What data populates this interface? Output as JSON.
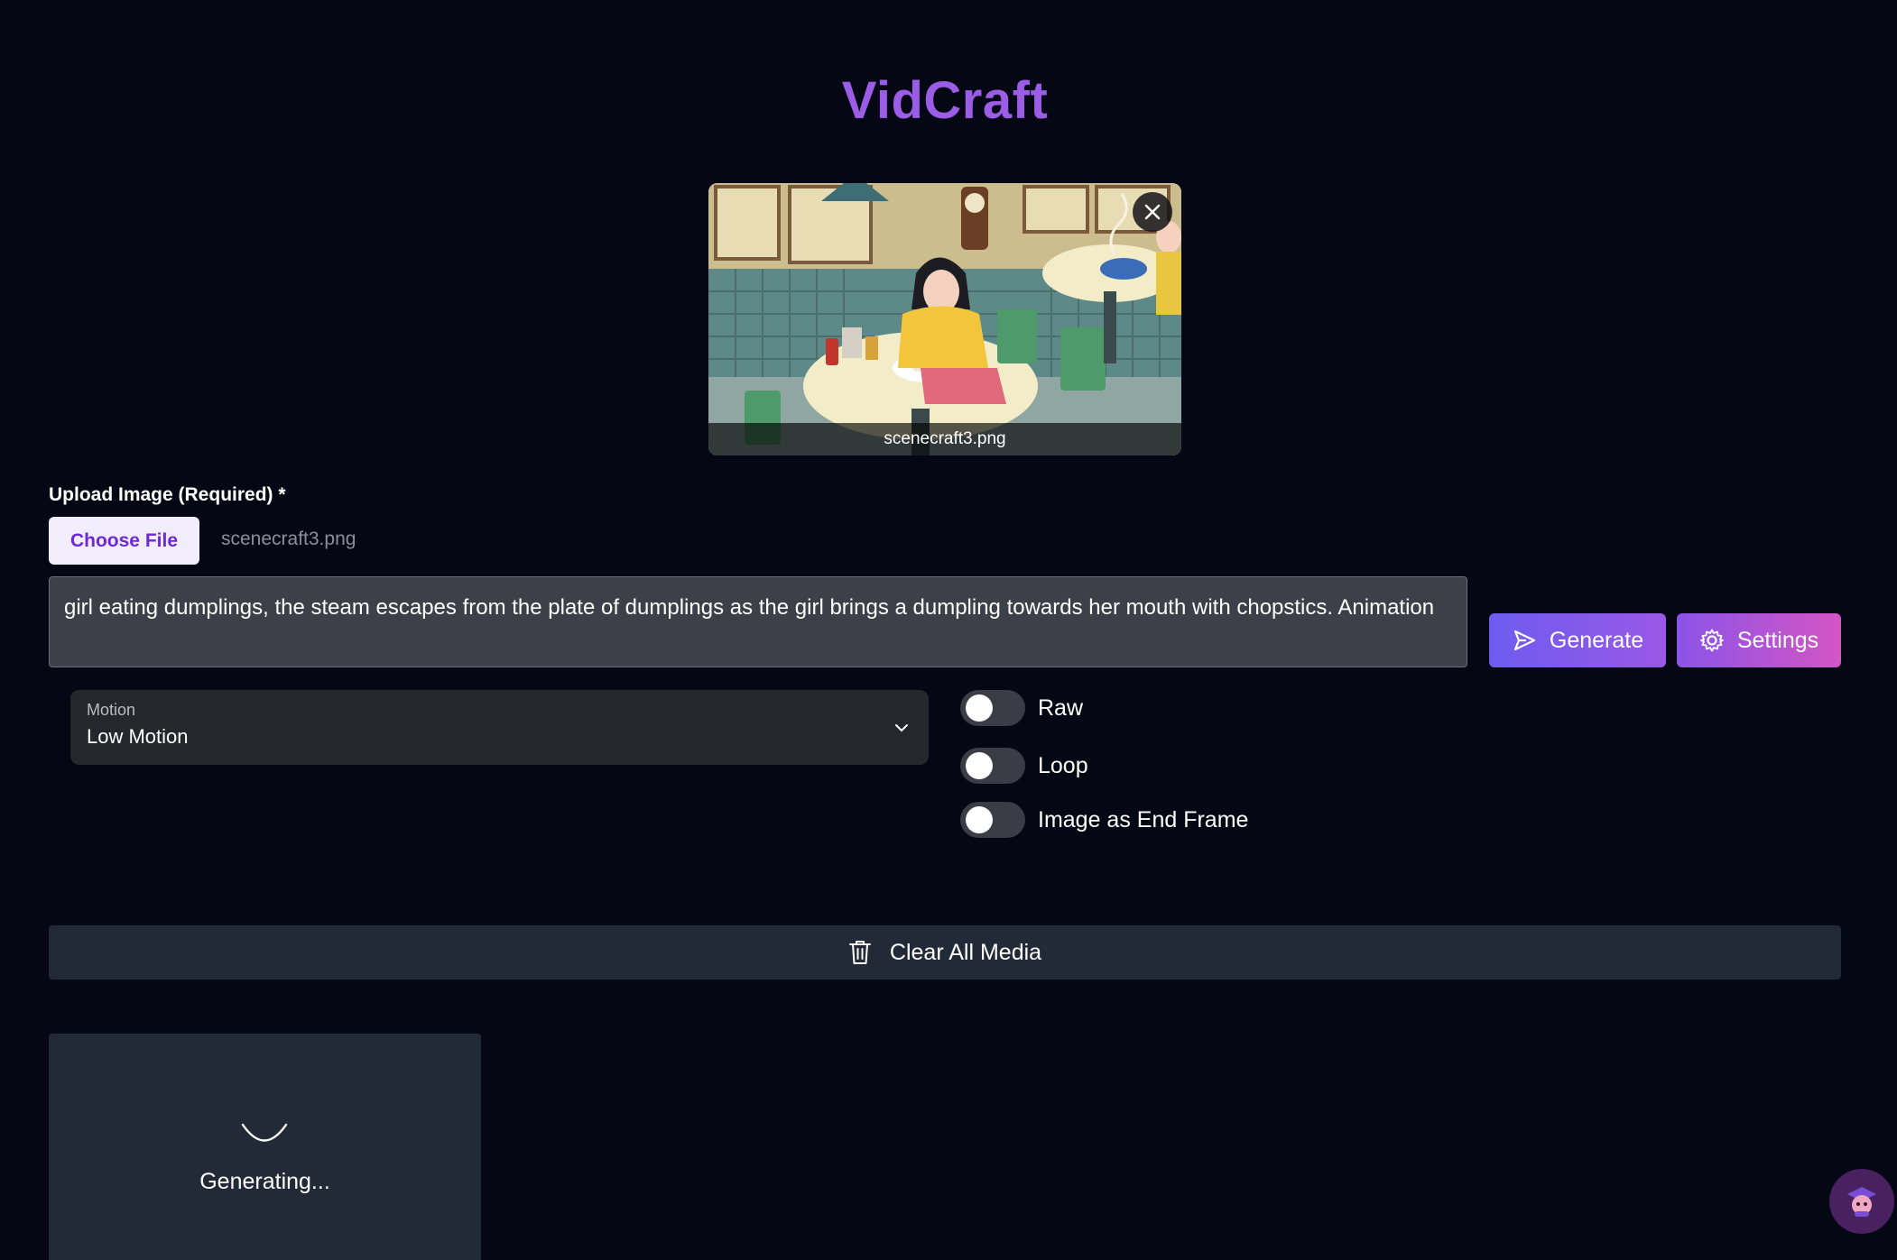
{
  "app": {
    "title": "VidCraft"
  },
  "preview": {
    "filename": "scenecraft3.png"
  },
  "upload": {
    "label": "Upload Image (Required) *",
    "button_label": "Choose File",
    "file_name": "scenecraft3.png"
  },
  "prompt": {
    "value": "girl eating dumplings, the steam escapes from the plate of dumplings as the girl brings a dumpling towards her mouth with chopstics. Animation"
  },
  "actions": {
    "generate_label": "Generate",
    "settings_label": "Settings"
  },
  "motion": {
    "label": "Motion",
    "value": "Low Motion"
  },
  "toggles": [
    {
      "label": "Raw",
      "on": false
    },
    {
      "label": "Loop",
      "on": false
    },
    {
      "label": "Image as End Frame",
      "on": false
    }
  ],
  "clear_all_label": "Clear All Media",
  "generation": {
    "status_text": "Generating..."
  },
  "colors": {
    "background": "#050814",
    "title": "#9b5de5",
    "generate_gradient": [
      "#6d5cf0",
      "#9a58e6"
    ],
    "settings_gradient": [
      "#8b54e8",
      "#d455c4"
    ]
  }
}
